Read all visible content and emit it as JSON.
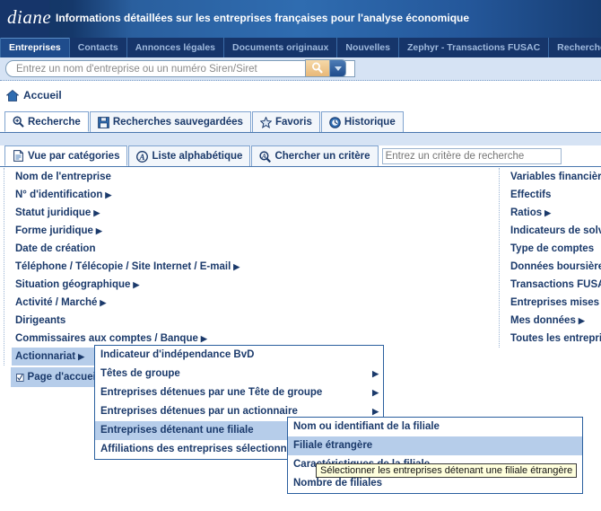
{
  "banner": {
    "logo": "diane",
    "tagline": "Informations détaillées sur les entreprises françaises pour l'analyse économique"
  },
  "main_tabs": [
    {
      "label": "Entreprises",
      "active": true
    },
    {
      "label": "Contacts",
      "active": false
    },
    {
      "label": "Annonces légales",
      "active": false
    },
    {
      "label": "Documents originaux",
      "active": false
    },
    {
      "label": "Nouvelles",
      "active": false
    },
    {
      "label": "Zephyr - Transactions FUSAC",
      "active": false
    },
    {
      "label": "Recherche sect",
      "active": false
    }
  ],
  "search": {
    "placeholder": "Entrez un nom d'entreprise ou un numéro Siren/Siret",
    "value": "",
    "go_icon": "magnifier-icon",
    "dropdown_icon": "caret-down-icon"
  },
  "breadcrumb": {
    "home_icon": "home-icon",
    "label": "Accueil"
  },
  "nav_tabs": [
    {
      "label": "Recherche",
      "icon": "magnifier-plus-icon",
      "active": true
    },
    {
      "label": "Recherches sauvegardées",
      "icon": "floppy-disk-icon",
      "active": false
    },
    {
      "label": "Favoris",
      "icon": "star-icon",
      "active": false
    },
    {
      "label": "Historique",
      "icon": "clock-icon",
      "active": false
    }
  ],
  "sub_tabs": [
    {
      "label": "Vue par catégories",
      "icon": "document-icon",
      "active": true
    },
    {
      "label": "Liste alphabétique",
      "icon": "circled-a-icon",
      "active": false
    },
    {
      "label": "Chercher un critère",
      "icon": "magnifier-a-icon",
      "active": false
    }
  ],
  "criteria_search": {
    "placeholder": "Entrez un critère de recherche",
    "value": ""
  },
  "left_column": [
    {
      "label": "Nom de l'entreprise",
      "has_submenu": false,
      "selected": false
    },
    {
      "label": "N° d'identification",
      "has_submenu": true,
      "selected": false
    },
    {
      "label": "Statut juridique",
      "has_submenu": true,
      "selected": false
    },
    {
      "label": "Forme juridique",
      "has_submenu": true,
      "selected": false
    },
    {
      "label": "Date de création",
      "has_submenu": false,
      "selected": false
    },
    {
      "label": "Téléphone / Télécopie / Site Internet / E-mail",
      "has_submenu": true,
      "selected": false
    },
    {
      "label": "Situation géographique",
      "has_submenu": true,
      "selected": false
    },
    {
      "label": "Activité / Marché",
      "has_submenu": true,
      "selected": false
    },
    {
      "label": "Dirigeants",
      "has_submenu": false,
      "selected": false
    },
    {
      "label": "Commissaires aux comptes / Banque",
      "has_submenu": true,
      "selected": false
    },
    {
      "label": "Actionnariat",
      "has_submenu": true,
      "selected": true
    }
  ],
  "right_column": [
    {
      "label": "Variables financières",
      "has_submenu": false,
      "selected": false
    },
    {
      "label": "Effectifs",
      "has_submenu": false,
      "selected": false
    },
    {
      "label": "Ratios",
      "has_submenu": true,
      "selected": false
    },
    {
      "label": "Indicateurs de solvabilité",
      "has_submenu": false,
      "selected": false
    },
    {
      "label": "Type de comptes",
      "has_submenu": false,
      "selected": false
    },
    {
      "label": "Données boursières",
      "has_submenu": false,
      "selected": false
    },
    {
      "label": "Transactions FUSAC",
      "has_submenu": false,
      "selected": false
    },
    {
      "label": "Entreprises mises à jour",
      "has_submenu": false,
      "selected": false
    },
    {
      "label": "Mes données",
      "has_submenu": true,
      "selected": false
    },
    {
      "label": "Toutes les entreprises",
      "has_submenu": false,
      "selected": false
    }
  ],
  "page_accueil": {
    "label": "Page d'accueil",
    "checked": true,
    "checkbox_icon": "checked-checkbox-icon"
  },
  "menu_level1": [
    {
      "label": "Indicateur d'indépendance BvD",
      "has_submenu": false,
      "selected": false
    },
    {
      "label": "Têtes de groupe",
      "has_submenu": true,
      "selected": false
    },
    {
      "label": "Entreprises détenues par une Tête de groupe",
      "has_submenu": true,
      "selected": false
    },
    {
      "label": "Entreprises détenues par un actionnaire",
      "has_submenu": true,
      "selected": false
    },
    {
      "label": "Entreprises détenant une filiale",
      "has_submenu": true,
      "selected": true
    },
    {
      "label": "Affiliations des entreprises sélectionnées",
      "has_submenu": false,
      "selected": false
    }
  ],
  "menu_level2": [
    {
      "label": "Nom ou identifiant de la filiale",
      "selected": false
    },
    {
      "label": "Filiale étrangère",
      "selected": true
    },
    {
      "label": "Caractéristiques de la filiale",
      "selected": false
    },
    {
      "label": "Nombre de filiales",
      "selected": false
    }
  ],
  "tooltip": {
    "text": "Sélectionner les entreprises détenant une filiale étrangère"
  },
  "colors": {
    "brand_navy": "#16356a",
    "banner_blue": "#2f6cb0",
    "highlight": "#b6cdea",
    "band": "#d6e3f4",
    "tooltip_bg": "#ffffdd"
  }
}
